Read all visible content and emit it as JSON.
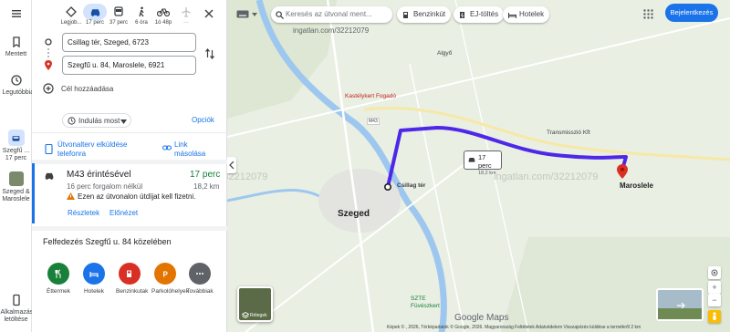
{
  "rail": {
    "saved": "Mentett",
    "recent": "Legutóbbiak",
    "trip_label": "Szegfű ...",
    "trip_time": "17 perc",
    "place_label": "Szeged & Maroslele",
    "apps_label": "Alkalmazás letöltése"
  },
  "modes": [
    {
      "label": "Legjob...",
      "icon": "diamond-route-icon"
    },
    {
      "label": "17 perc",
      "icon": "car-icon",
      "selected": true
    },
    {
      "label": "37 perc",
      "icon": "bus-icon"
    },
    {
      "label": "6 óra",
      "icon": "walk-icon"
    },
    {
      "label": "1ó 48p",
      "icon": "bike-icon"
    },
    {
      "label": "—",
      "icon": "plane-icon"
    }
  ],
  "origin": "Csillag tér, Szeged, 6723",
  "destination": "Szegfű u. 84, Maroslele, 6921",
  "add_destination": "Cél hozzáadása",
  "depart_now": "Indulás most",
  "options": "Opciók",
  "send_to_phone": "Útvonalterv elküldése telefonra",
  "copy_link": "Link másolása",
  "route": {
    "via": "M43 érintésével",
    "time": "17 perc",
    "traffic": "16 perc forgalom nélkül",
    "distance": "18,2 km",
    "toll_warning": "Ezen az útvonalon útdíjat kell fizetni.",
    "details": "Részletek",
    "preview": "Előnézet"
  },
  "explore_title": "Felfedezés Szegfű u. 84 közelében",
  "categories": [
    {
      "label": "Éttermek",
      "color": "#188038",
      "icon": "restaurant-icon"
    },
    {
      "label": "Hotelek",
      "color": "#1a73e8",
      "icon": "hotel-icon"
    },
    {
      "label": "Benzinkutak",
      "color": "#d93025",
      "icon": "gas-station-icon"
    },
    {
      "label": "Parkolóhelyek",
      "color": "#e37400",
      "icon": "parking-icon"
    },
    {
      "label": "Továbbiak",
      "color": "#5f6368",
      "icon": "more-icon"
    }
  ],
  "map": {
    "search_placeholder": "Keresés az útvonal ment...",
    "chips": [
      "Benzinkút",
      "EJ-töltés",
      "Hotelek"
    ],
    "signin": "Bejelentkezés",
    "places": {
      "szeged": "Szeged",
      "maroslele": "Maroslele",
      "algyo": "Algyő",
      "castle": "Kastélykert Fogadó",
      "csillag": "Csillag tér",
      "szte": "SZTE Füvészkert",
      "trans": "Transmisszió Kft"
    },
    "road_m43": "M43",
    "route_bubble_time": "17 perc",
    "route_bubble_dist": "18,2 km",
    "layers": "Rétegek",
    "google_maps": "Google Maps",
    "footer": "Képek © , 2026, Térképadatok © Google, 2026.   Magyarország   Feltételek   Adatvédelem   Visszajelzés küldése a termékről   2 km",
    "watermark": "ingatlan.com/32212079",
    "route_color": "#4d28e8"
  }
}
